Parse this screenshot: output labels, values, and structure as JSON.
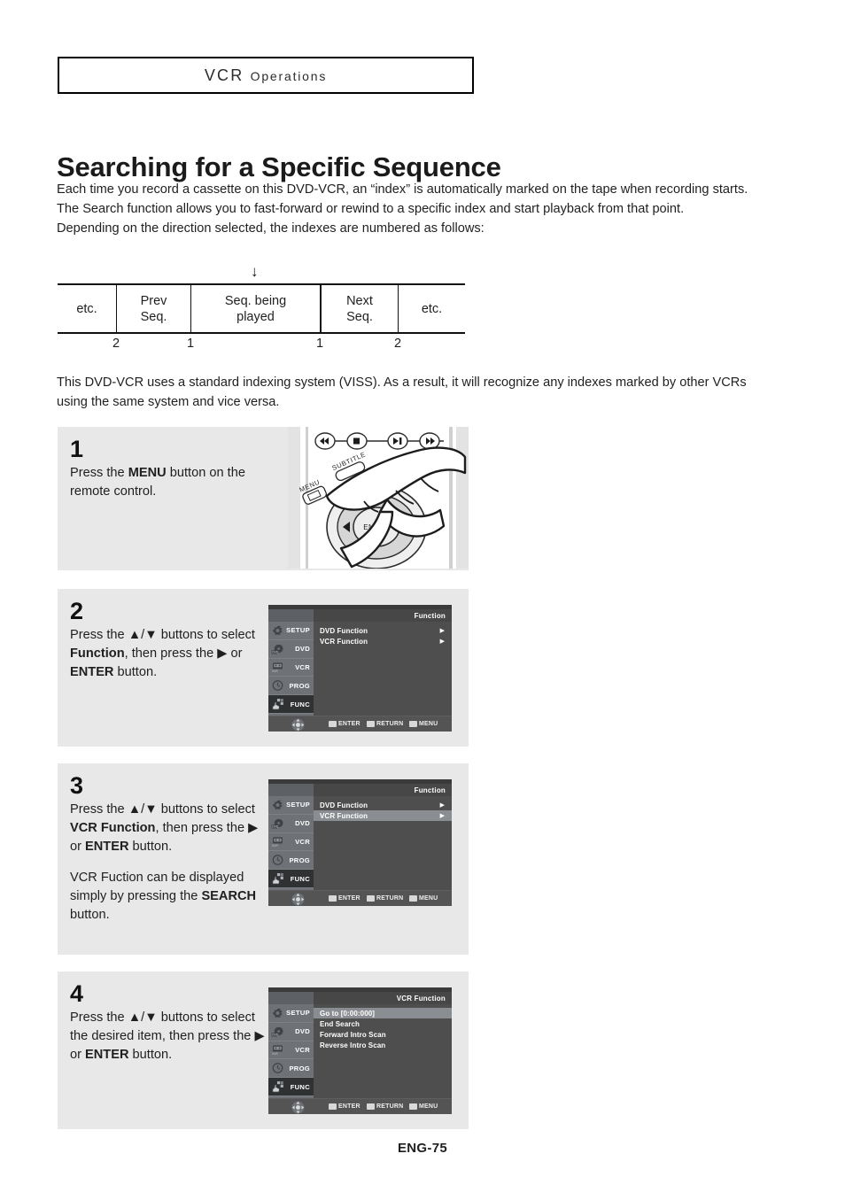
{
  "running_head": {
    "main": "VCR",
    "small_caps": "Operations"
  },
  "page_title": "Searching for a Specific Sequence",
  "intro_paragraph": "Each time you record a cassette on this DVD-VCR, an “index” is automatically marked on the tape when recording starts.\nThe Search function allows you to fast-forward or rewind to a specific index and start playback from that point.\nDepending on the direction selected, the indexes are numbered as follows:",
  "diagram": {
    "arrow": "↓",
    "cells": [
      "etc.",
      "Prev\nSeq.",
      "Seq. being\nplayed",
      "Next\nSeq.",
      "etc."
    ],
    "numbers": [
      "2",
      "1",
      "1",
      "2"
    ]
  },
  "viss_paragraph": "This DVD-VCR uses a standard indexing system (VISS). As a result, it will recognize any indexes marked by other VCRs using the same system and vice versa.",
  "steps": [
    {
      "number": "1",
      "paragraphs": [
        [
          {
            "t": "Press the ",
            "b": false
          },
          {
            "t": "MENU",
            "b": true
          },
          {
            "t": " button on the remote control.",
            "b": false
          }
        ]
      ],
      "illustration": "remote-control-menu-press"
    },
    {
      "number": "2",
      "paragraphs": [
        [
          {
            "t": "Press the ▲/▼ buttons to select ",
            "b": false
          },
          {
            "t": "Function",
            "b": true
          },
          {
            "t": ", then press the ▶ or ",
            "b": false
          },
          {
            "t": "ENTER",
            "b": true
          },
          {
            "t": " button.",
            "b": false
          }
        ]
      ]
    },
    {
      "number": "3",
      "paragraphs": [
        [
          {
            "t": "Press the ▲/▼ buttons to select ",
            "b": false
          },
          {
            "t": "VCR Function",
            "b": true
          },
          {
            "t": ", then press the ▶ or ",
            "b": false
          },
          {
            "t": "ENTER",
            "b": true
          },
          {
            "t": " button.",
            "b": false
          }
        ],
        [
          {
            "t": "VCR Fuction can be displayed simply by pressing the ",
            "b": false
          },
          {
            "t": "SEARCH",
            "b": true
          },
          {
            "t": " button.",
            "b": false
          }
        ]
      ]
    },
    {
      "number": "4",
      "paragraphs": [
        [
          {
            "t": "Press the ▲/▼ buttons to select the desired item, then press the ▶ or ",
            "b": false
          },
          {
            "t": "ENTER",
            "b": true
          },
          {
            "t": " button.",
            "b": false
          }
        ]
      ]
    }
  ],
  "osd_screens": [
    {
      "title": "Function",
      "sidebar": [
        {
          "label": "SETUP",
          "icon": "gear-icon",
          "active": false
        },
        {
          "label": "DVD",
          "icon": "disc-icon",
          "active": false
        },
        {
          "label": "VCR",
          "icon": "cassette-icon",
          "active": false
        },
        {
          "label": "PROG",
          "icon": "clock-icon",
          "active": false
        },
        {
          "label": "FUNC",
          "icon": "hand-blocks-icon",
          "active": true
        }
      ],
      "rows": [
        {
          "label": "DVD Function",
          "arrow": "▶",
          "selected": false
        },
        {
          "label": "VCR Function",
          "arrow": "▶",
          "selected": false
        }
      ],
      "hints": [
        {
          "label": "ENTER",
          "icon": "enter-button-icon"
        },
        {
          "label": "RETURN",
          "icon": "return-button-icon"
        },
        {
          "label": "MENU",
          "icon": "menu-button-icon"
        }
      ]
    },
    {
      "title": "Function",
      "sidebar": [
        {
          "label": "SETUP",
          "icon": "gear-icon",
          "active": false
        },
        {
          "label": "DVD",
          "icon": "disc-icon",
          "active": false
        },
        {
          "label": "VCR",
          "icon": "cassette-icon",
          "active": false
        },
        {
          "label": "PROG",
          "icon": "clock-icon",
          "active": false
        },
        {
          "label": "FUNC",
          "icon": "hand-blocks-icon",
          "active": true
        }
      ],
      "rows": [
        {
          "label": "DVD Function",
          "arrow": "▶",
          "selected": false
        },
        {
          "label": "VCR Function",
          "arrow": "▶",
          "selected": true
        }
      ],
      "hints": [
        {
          "label": "ENTER",
          "icon": "enter-button-icon"
        },
        {
          "label": "RETURN",
          "icon": "return-button-icon"
        },
        {
          "label": "MENU",
          "icon": "menu-button-icon"
        }
      ]
    },
    {
      "title": "VCR Function",
      "sidebar": [
        {
          "label": "SETUP",
          "icon": "gear-icon",
          "active": false
        },
        {
          "label": "DVD",
          "icon": "disc-icon",
          "active": false
        },
        {
          "label": "VCR",
          "icon": "cassette-icon",
          "active": false
        },
        {
          "label": "PROG",
          "icon": "clock-icon",
          "active": false
        },
        {
          "label": "FUNC",
          "icon": "hand-blocks-icon",
          "active": true
        }
      ],
      "rows": [
        {
          "label": "Go to [0:00:000]",
          "arrow": "",
          "selected": true
        },
        {
          "label": "End Search",
          "arrow": "",
          "selected": false
        },
        {
          "label": "Forward Intro Scan",
          "arrow": "",
          "selected": false
        },
        {
          "label": "Reverse Intro Scan",
          "arrow": "",
          "selected": false
        }
      ],
      "hints": [
        {
          "label": "ENTER",
          "icon": "enter-button-icon"
        },
        {
          "label": "RETURN",
          "icon": "return-button-icon"
        },
        {
          "label": "MENU",
          "icon": "menu-button-icon"
        }
      ]
    }
  ],
  "remote_labels": {
    "menu": "MENU",
    "subtitle": "SUBTITLE",
    "enter": "ENTER"
  },
  "footer": "ENG-75",
  "colors": {
    "panel_bg": "#e8e8e8",
    "osd_bg": "#4e4e4e",
    "osd_sidebar": "#6e7277",
    "osd_active": "#2f3133",
    "osd_selected": "#8a8e93"
  }
}
